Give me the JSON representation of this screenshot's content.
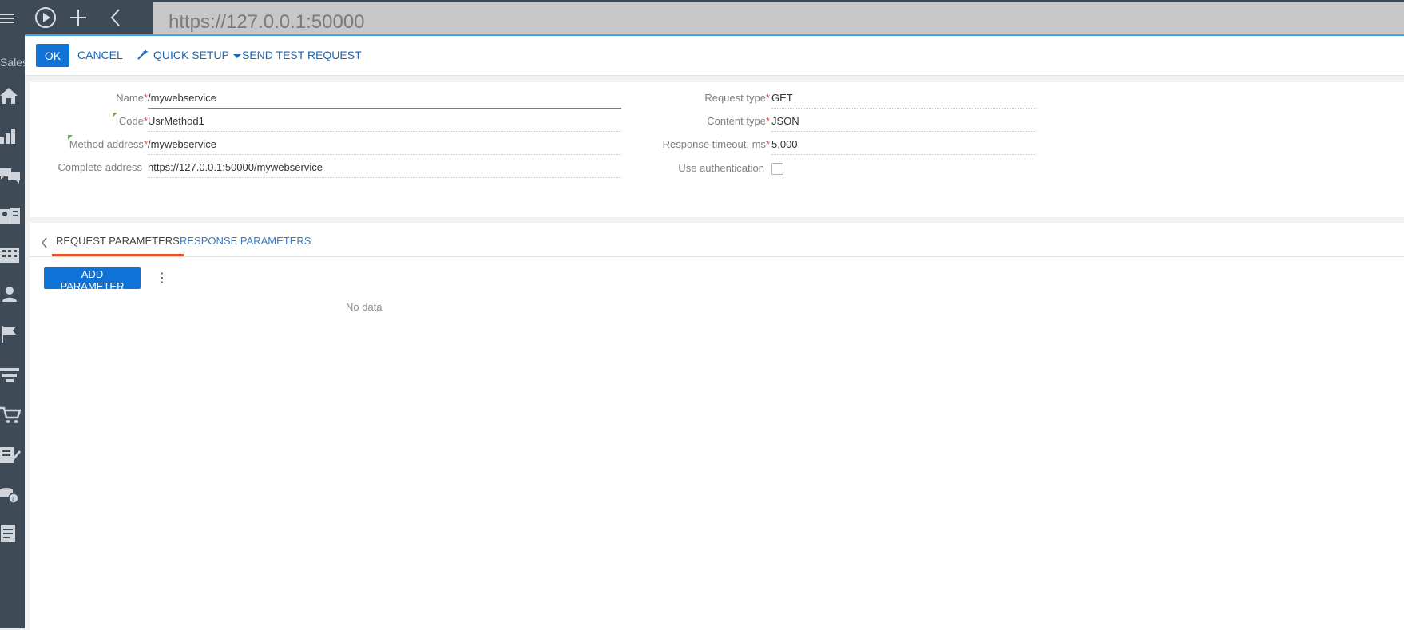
{
  "browser": {
    "url": "https://127.0.0.1:50000"
  },
  "sidebar": {
    "section_label": "Sales",
    "icons": [
      "home-icon",
      "dashboard-icon",
      "feed-icon",
      "contacts-icon",
      "accounts-icon",
      "user-icon",
      "flag-icon",
      "funnel-icon",
      "cart-icon",
      "document-icon",
      "coins-icon",
      "page-icon"
    ]
  },
  "actions": {
    "ok": "OK",
    "cancel": "CANCEL",
    "quick_setup": "QUICK SETUP",
    "send_test_request": "SEND TEST REQUEST"
  },
  "fields": {
    "name": {
      "label": "Name",
      "value": "/mywebservice"
    },
    "code": {
      "label": "Code",
      "value": "UsrMethod1"
    },
    "method_address": {
      "label": "Method address",
      "value": "/mywebservice"
    },
    "complete_address": {
      "label": "Complete address",
      "value": "https://127.0.0.1:50000/mywebservice"
    },
    "request_type": {
      "label": "Request type",
      "value": "GET"
    },
    "content_type": {
      "label": "Content type",
      "value": "JSON"
    },
    "response_timeout": {
      "label": "Response timeout, ms",
      "value": "5,000"
    },
    "use_authentication": {
      "label": "Use authentication",
      "checked": false
    }
  },
  "tabs": {
    "request_parameters": "REQUEST PARAMETERS",
    "response_parameters": "RESPONSE PARAMETERS"
  },
  "grid": {
    "add_parameter": "ADD PARAMETER",
    "empty_text": "No data"
  },
  "colors": {
    "primary": "#0e72d6",
    "link": "#1a66b8",
    "active_tab_underline": "#ee5126",
    "sidebar": "#3f4a57"
  }
}
